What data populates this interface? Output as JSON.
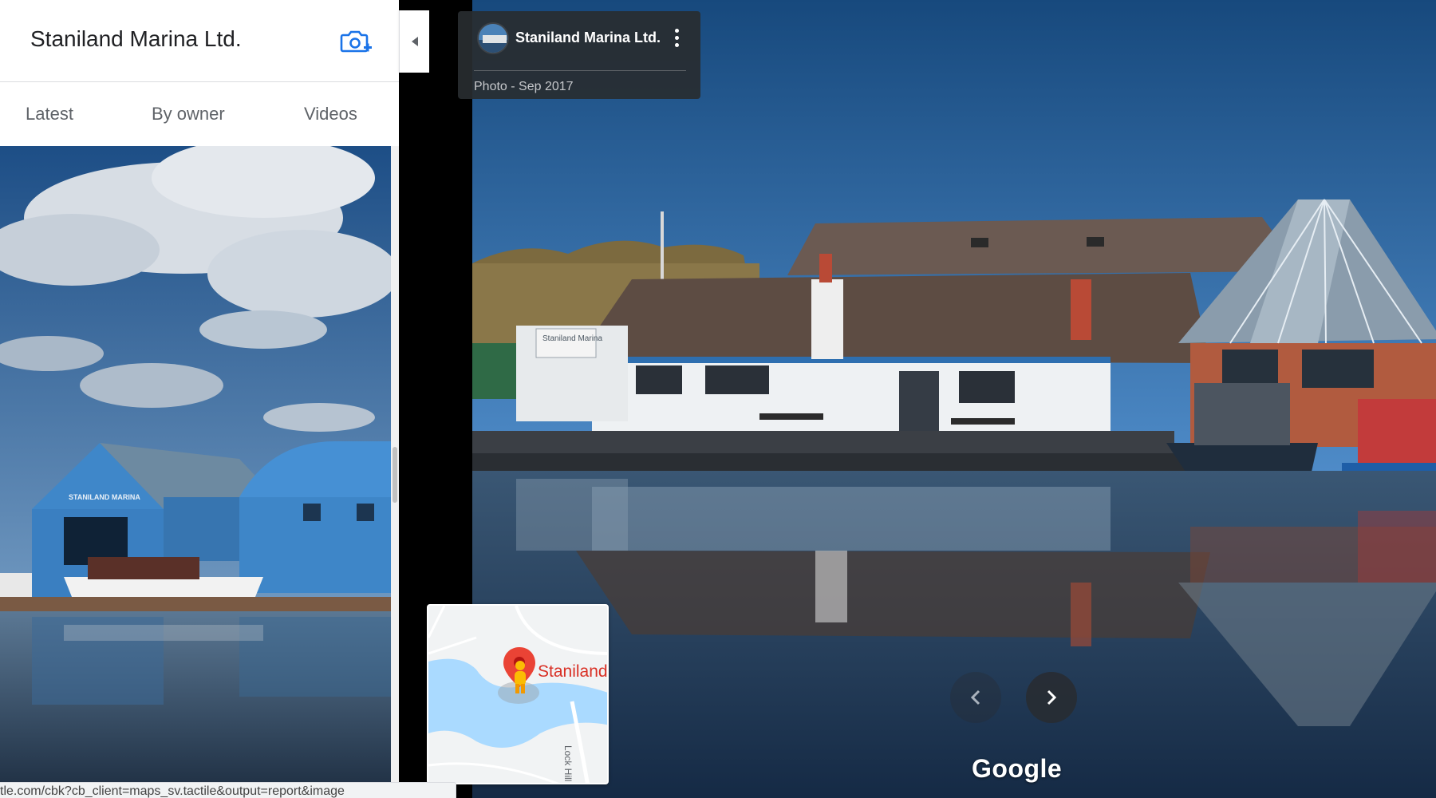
{
  "place": {
    "title": "Staniland Marina Ltd.",
    "add_photo_icon": "camera-plus-icon"
  },
  "tabs": [
    {
      "label": "Latest"
    },
    {
      "label": "By owner"
    },
    {
      "label": "Videos"
    }
  ],
  "viewer": {
    "card_title": "Staniland Marina Ltd.",
    "photo_date": "Photo - Sep 2017",
    "menu_icon": "more-vert-icon",
    "prev_icon": "chevron-left-icon",
    "next_icon": "chevron-right-icon",
    "watermark": "Google"
  },
  "minimap": {
    "place_label": "Staniland",
    "road_label": "Lock Hill",
    "marker_icon": "map-pin-icon",
    "pegman_icon": "pegman-icon"
  },
  "building_sign": "Staniland Marina",
  "boathouse_sign": "STANILAND MARINA",
  "status_bar": {
    "url": "tle.com/cbk?cb_client=maps_sv.tactile&output=report&image"
  },
  "colors": {
    "accent": "#1a73e8",
    "marker": "#ea4335",
    "card_bg": "#282c30"
  }
}
